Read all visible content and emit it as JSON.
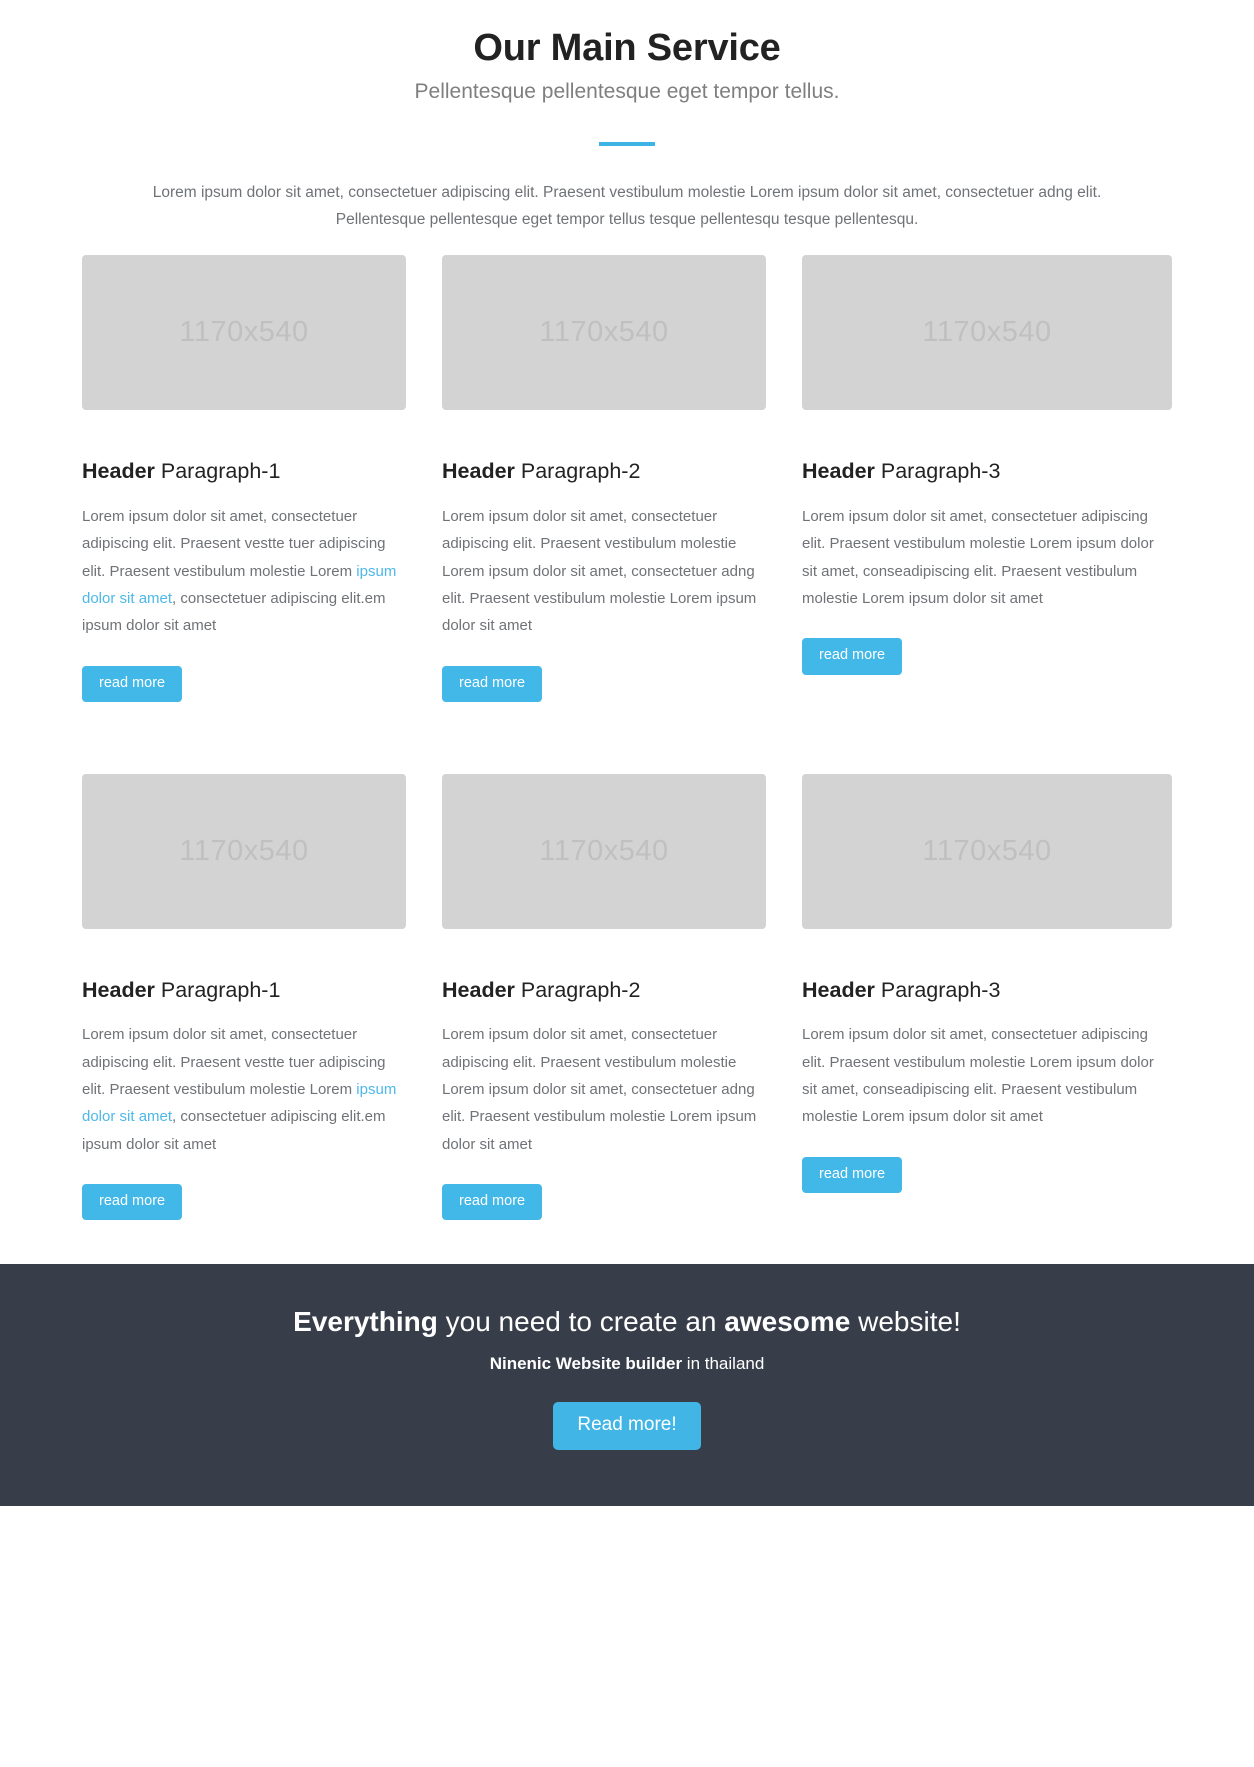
{
  "section": {
    "title": "Our Main Service",
    "subtitle": "Pellentesque pellentesque eget tempor tellus.",
    "divider_color": "#3cb4e5",
    "intro_line_1": "Lorem ipsum dolor sit amet, consectetuer adipiscing elit. Praesent vestibulum molestie Lorem ipsum dolor sit amet, consectetuer adng elit.",
    "intro_line_2": "Pellentesque pellentesque eget tempor tellus tesque pellentesqu tesque pellentesqu."
  },
  "theme": {
    "accent": "#42b8e9",
    "link": "#4db8ea",
    "cta_background": "#373e49",
    "placeholder_background": "#d3d3d3",
    "body_text": "#6f7276"
  },
  "cards": [
    {
      "thumb_label": "1170x540",
      "title_bold": "Header",
      "title_rest": " Paragraph-1",
      "body_pre": "Lorem ipsum dolor sit amet, consectetuer adipiscing elit. Praesent vestte tuer adipiscing elit. Praesent vestibulum molestie Lorem ",
      "body_link": "ipsum dolor sit amet",
      "body_post": ", consectetuer adipiscing elit.em ipsum dolor sit amet",
      "button_label": "read more"
    },
    {
      "thumb_label": "1170x540",
      "title_bold": "Header",
      "title_rest": " Paragraph-2",
      "body_pre": "Lorem ipsum dolor sit amet, consectetuer adipiscing elit. Praesent vestibulum molestie Lorem ipsum dolor sit amet, consectetuer adng elit. Praesent vestibulum molestie Lorem ipsum dolor sit amet",
      "body_link": "",
      "body_post": "",
      "button_label": "read more"
    },
    {
      "thumb_label": "1170x540",
      "title_bold": "Header",
      "title_rest": " Paragraph-3",
      "body_pre": "Lorem ipsum dolor sit amet, consectetuer adipiscing elit. Praesent vestibulum molestie Lorem ipsum dolor sit amet, conseadipiscing elit. Praesent vestibulum molestie Lorem ipsum dolor sit amet",
      "body_link": "",
      "body_post": "",
      "button_label": "read more"
    },
    {
      "thumb_label": "1170x540",
      "title_bold": "Header",
      "title_rest": " Paragraph-1",
      "body_pre": "Lorem ipsum dolor sit amet, consectetuer adipiscing elit. Praesent vestte tuer adipiscing elit. Praesent vestibulum molestie Lorem ",
      "body_link": "ipsum dolor sit amet",
      "body_post": ", consectetuer adipiscing elit.em ipsum dolor sit amet",
      "button_label": "read more"
    },
    {
      "thumb_label": "1170x540",
      "title_bold": "Header",
      "title_rest": " Paragraph-2",
      "body_pre": "Lorem ipsum dolor sit amet, consectetuer adipiscing elit. Praesent vestibulum molestie Lorem ipsum dolor sit amet, consectetuer adng elit. Praesent vestibulum molestie Lorem ipsum dolor sit amet",
      "body_link": "",
      "body_post": "",
      "button_label": "read more"
    },
    {
      "thumb_label": "1170x540",
      "title_bold": "Header",
      "title_rest": " Paragraph-3",
      "body_pre": "Lorem ipsum dolor sit amet, consectetuer adipiscing elit. Praesent vestibulum molestie Lorem ipsum dolor sit amet, conseadipiscing elit. Praesent vestibulum molestie Lorem ipsum dolor sit amet",
      "body_link": "",
      "body_post": "",
      "button_label": "read more"
    }
  ],
  "cta": {
    "title_a": "Everything",
    "title_b": " you need to create an ",
    "title_c": "awesome",
    "title_d": " website!",
    "sub_bold": "Ninenic Website builder",
    "sub_rest": " in thailand",
    "button_label": "Read more!"
  }
}
